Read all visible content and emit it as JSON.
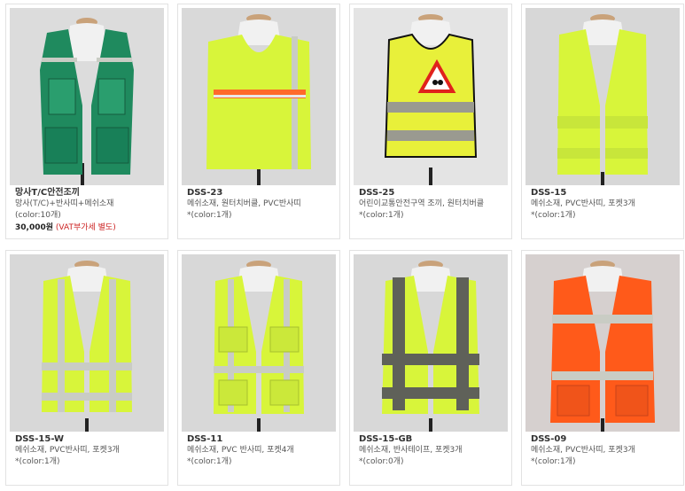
{
  "products": [
    {
      "title": "망사T/C안전조끼",
      "desc": "망사(T/C)+반사띠+메쉬소재",
      "color_count": "(color:10개)",
      "price": "30,000원",
      "vat_note": "(VAT부가세 별도)",
      "vest_icon": "green-mesh-vest-icon"
    },
    {
      "title": "DSS-23",
      "desc": "메쉬소재, 원터치버클, PVC반사띠",
      "color_count": "*(color:1개)",
      "vest_icon": "yellow-pullover-vest-orange-band-icon"
    },
    {
      "title": "DSS-25",
      "desc": "어린이교통안전구역 조끼, 원터치버클",
      "color_count": "*(color:1개)",
      "vest_icon": "school-zone-vest-icon"
    },
    {
      "title": "DSS-15",
      "desc": "메쉬소재, PVC반사띠, 포켓3개",
      "color_count": "*(color:1개)",
      "vest_icon": "yellow-mesh-vest-icon"
    },
    {
      "title": "DSS-15-W",
      "desc": "메쉬소재, PVC반사띠, 포켓3개",
      "color_count": "*(color:1개)",
      "vest_icon": "yellow-vest-white-stripes-icon"
    },
    {
      "title": "DSS-11",
      "desc": "메쉬소재, PVC 반사띠, 포켓4개",
      "color_count": "*(color:1개)",
      "vest_icon": "yellow-vest-four-pockets-icon"
    },
    {
      "title": "DSS-15-GB",
      "desc": "메쉬소재, 반사테이프, 포켓3개",
      "color_count": "*(color:0개)",
      "vest_icon": "yellow-vest-gray-bands-icon"
    },
    {
      "title": "DSS-09",
      "desc": "메쉬소재, PVC반사띠, 포켓3개",
      "color_count": "*(color:1개)",
      "vest_icon": "orange-mesh-vest-icon"
    }
  ],
  "colors": {
    "neon_yellow": "#d8f53a",
    "mesh_green": "#1f8a5e",
    "safety_orange": "#ff5a1a",
    "reflective_silver": "#c9ccc4",
    "vat_red": "#cc2222"
  }
}
